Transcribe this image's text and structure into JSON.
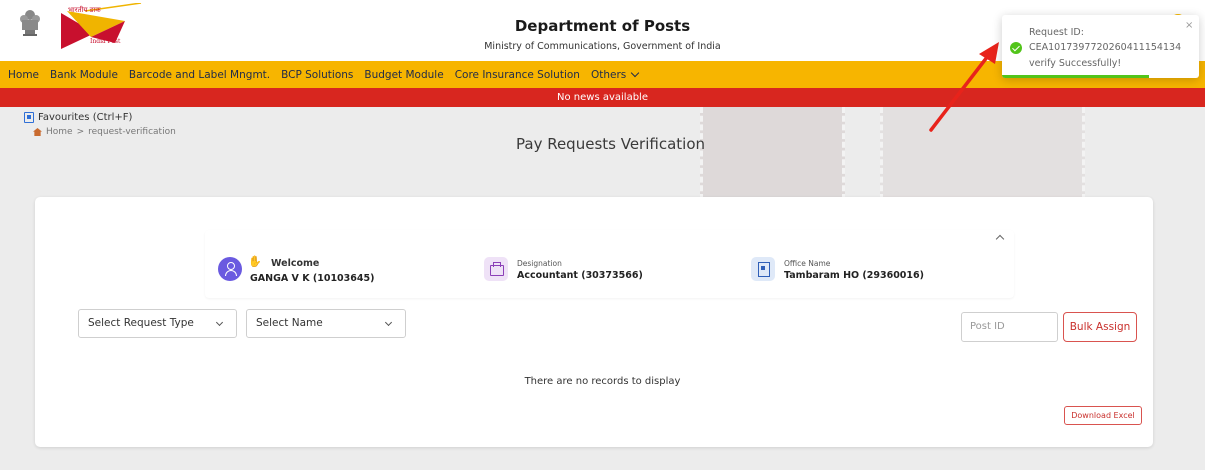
{
  "header": {
    "logo_hindi": "भारतीय डाक",
    "logo_text": "India Post",
    "title": "Department of Posts",
    "subtitle": "Ministry of Communications, Government of India"
  },
  "nav": {
    "items": [
      {
        "label": "Home"
      },
      {
        "label": "Bank Module"
      },
      {
        "label": "Barcode and Label Mngmt."
      },
      {
        "label": "BCP Solutions"
      },
      {
        "label": "Budget Module"
      },
      {
        "label": "Core Insurance Solution"
      },
      {
        "label": "Others"
      }
    ]
  },
  "news": {
    "text": "No news available"
  },
  "favourites": {
    "label": "Favourites (Ctrl+F)"
  },
  "breadcrumb": {
    "home": "Home",
    "separator": ">",
    "current": "request-verification"
  },
  "page": {
    "title": "Pay Requests Verification"
  },
  "info": {
    "welcome_label": "Welcome",
    "welcome_name": "GANGA V K (10103645)",
    "designation_label": "Designation",
    "designation_value": "Accountant (30373566)",
    "office_label": "Office Name",
    "office_value": "Tambaram HO (29360016)"
  },
  "filters": {
    "request_type": "Select Request Type",
    "name": "Select Name",
    "post_id_placeholder": "Post ID",
    "bulk_assign": "Bulk Assign"
  },
  "table": {
    "empty_message": "There are no records to display"
  },
  "download": {
    "label": "Download Excel"
  },
  "toast": {
    "title": "Request ID:",
    "request_id": "CEA1017397720260411154134",
    "message": "verify Successfully!",
    "close": "×"
  },
  "colors": {
    "nav_bg": "#f7b500",
    "news_bg": "#d8261f",
    "accent_red": "#d9534f",
    "success": "#52c41a"
  }
}
